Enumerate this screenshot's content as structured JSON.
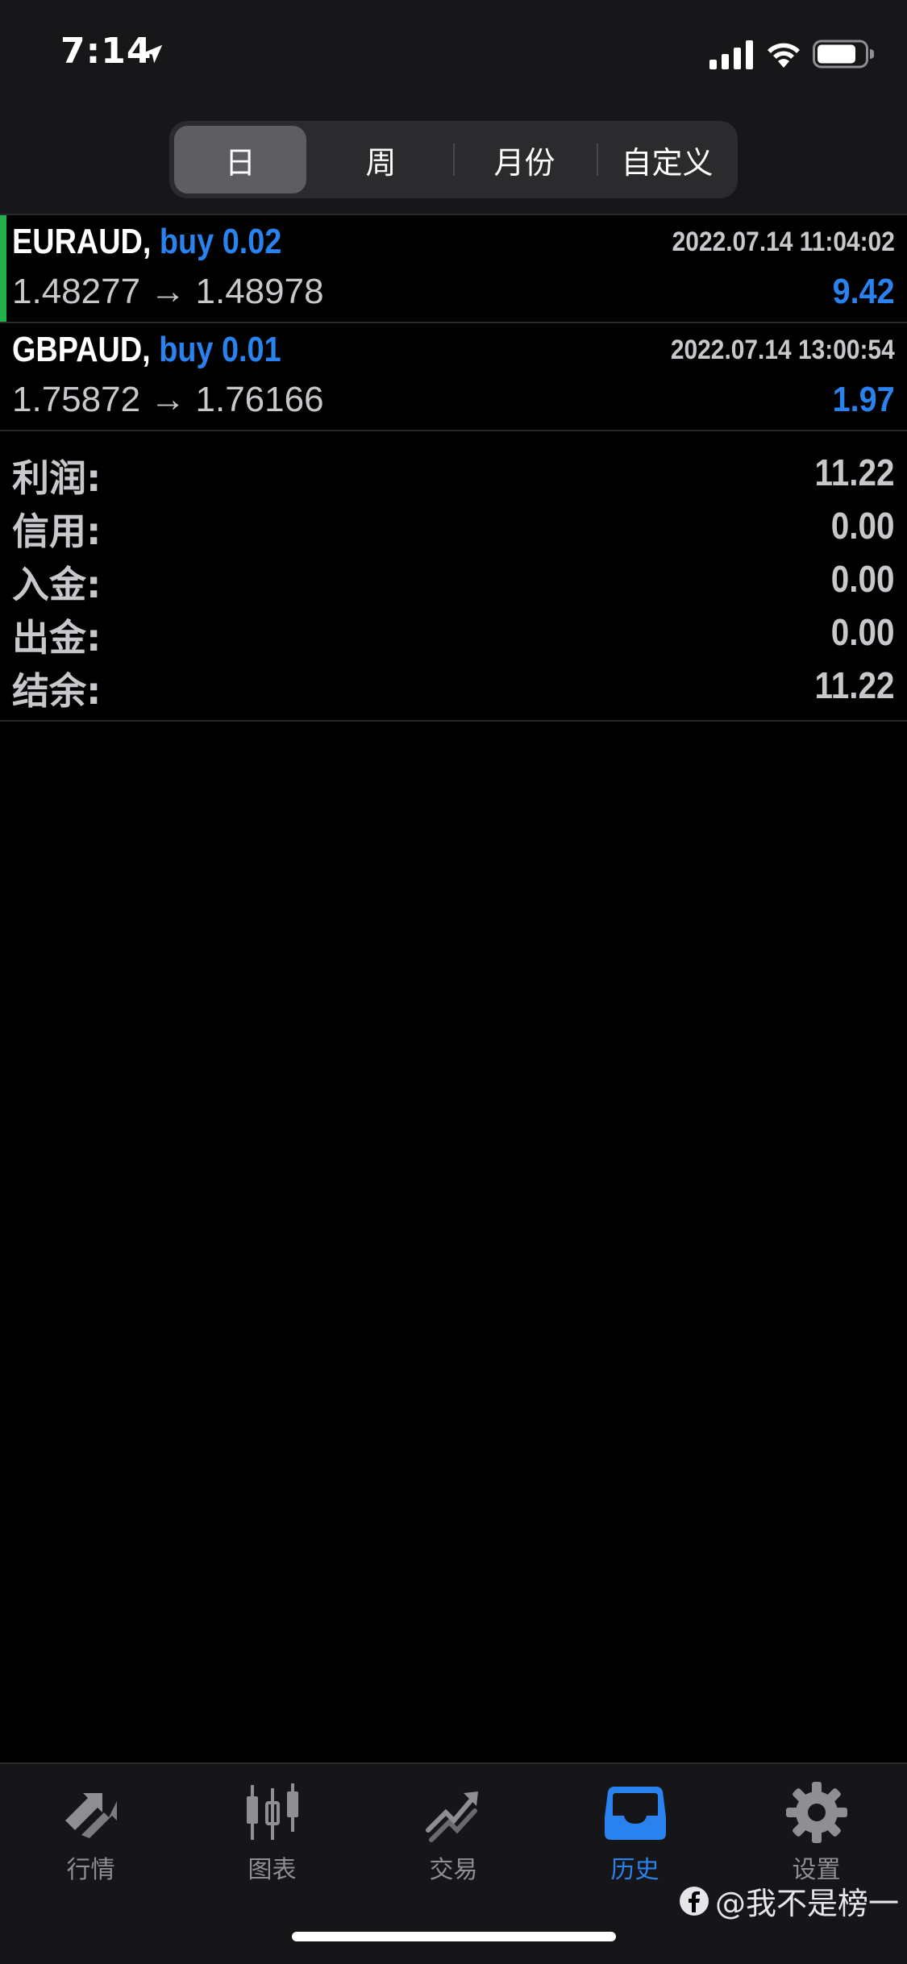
{
  "status_bar": {
    "time": "7:14",
    "icons": [
      "location-arrow-icon",
      "signal-icon",
      "wifi-icon",
      "battery-icon"
    ]
  },
  "segments": {
    "items": [
      "日",
      "周",
      "月份",
      "自定义"
    ],
    "selected": "日"
  },
  "trades": [
    {
      "symbol": "EURAUD,",
      "side": "buy 0.02",
      "time": "2022.07.14 11:04:02",
      "prices": "1.48277 → 1.48978",
      "profit": "9.42"
    },
    {
      "symbol": "GBPAUD,",
      "side": "buy 0.01",
      "time": "2022.07.14 13:00:54",
      "prices": "1.75872 → 1.76166",
      "profit": "1.97"
    }
  ],
  "summary": [
    {
      "label": "利润:",
      "value": "11.22"
    },
    {
      "label": "信用:",
      "value": "0.00"
    },
    {
      "label": "入金:",
      "value": "0.00"
    },
    {
      "label": "出金:",
      "value": "0.00"
    },
    {
      "label": "结余:",
      "value": "11.22"
    }
  ],
  "tab_bar": {
    "items": [
      {
        "label": "行情",
        "icon": "quotes-arrows-icon"
      },
      {
        "label": "图表",
        "icon": "candlestick-chart-icon"
      },
      {
        "label": "交易",
        "icon": "trade-trend-icon"
      },
      {
        "label": "历史",
        "icon": "history-inbox-icon"
      },
      {
        "label": "设置",
        "icon": "gear-icon"
      }
    ],
    "active": "历史"
  },
  "watermark": "@我不是榜一",
  "colors": {
    "accent_blue": "#2a82ef",
    "accent_green": "#22b14c",
    "background": "#000000",
    "bar_background": "#171719"
  }
}
